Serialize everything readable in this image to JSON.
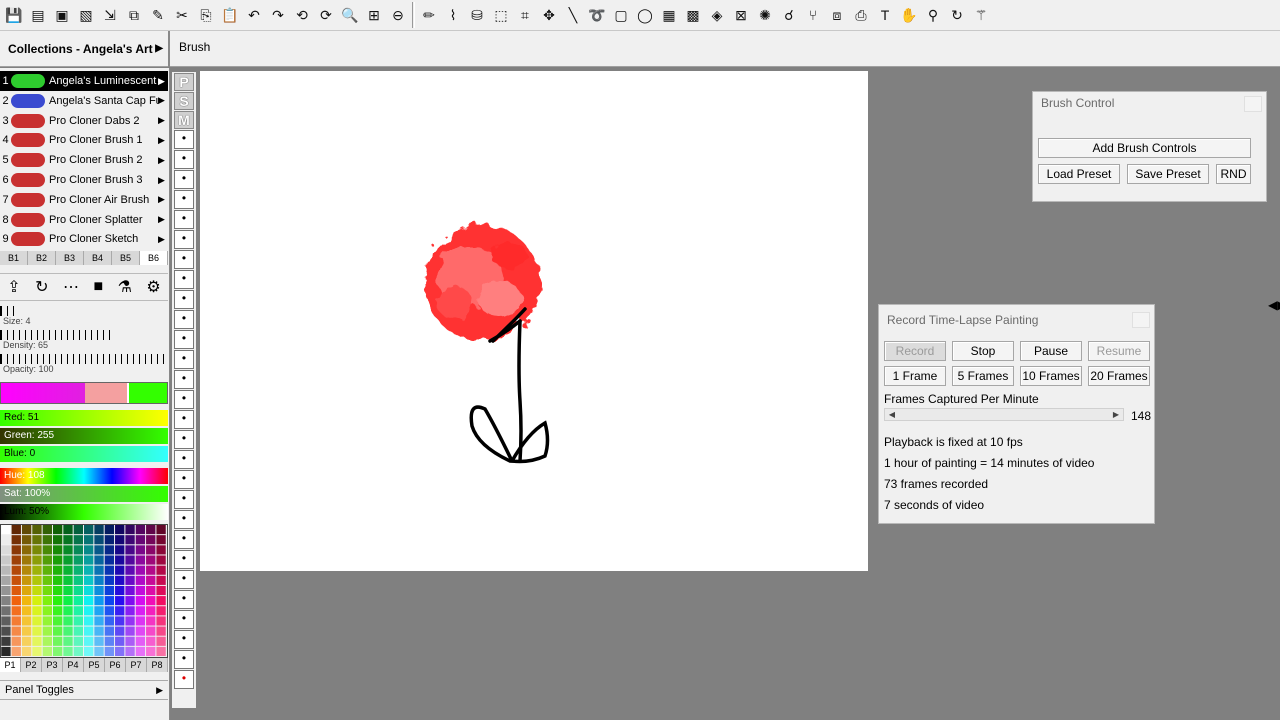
{
  "toolbar": {
    "icons": [
      "save-icon",
      "new-icon",
      "open-icon",
      "save-as-icon",
      "export-icon",
      "export-all-icon",
      "pen-icon",
      "cut-icon",
      "copy-icon",
      "paste-icon",
      "undo-icon",
      "redo-icon",
      "rotate-left-icon",
      "rotate-right-icon",
      "zoom-icon",
      "fit-icon",
      "zoom-out-icon",
      "brush-icon",
      "eyedropper-icon",
      "bucket-icon",
      "select-rect-icon",
      "crop-icon",
      "move-icon",
      "line-icon",
      "lasso-icon",
      "rect-icon",
      "ellipse-icon",
      "pattern-icon",
      "checker-icon",
      "texture-icon",
      "grid-icon",
      "noise-icon",
      "smudge-icon",
      "fork-icon",
      "layers-icon",
      "camera-icon",
      "text-icon",
      "hand-icon",
      "hook-icon",
      "refresh-icon",
      "wand-icon"
    ]
  },
  "header": {
    "collections_label": "Collections - Angela's Art",
    "brush_label": "Brush"
  },
  "brushes": [
    {
      "num": "1",
      "name": "Angela's Luminescent Grass",
      "color": "#2ecc2e"
    },
    {
      "num": "2",
      "name": "Angela's Santa Cap Fur",
      "color": "#3a4ad0"
    },
    {
      "num": "3",
      "name": "Pro Cloner Dabs 2",
      "color": "#c83030"
    },
    {
      "num": "4",
      "name": "Pro Cloner Brush 1",
      "color": "#c83030"
    },
    {
      "num": "5",
      "name": "Pro Cloner Brush 2",
      "color": "#c83030"
    },
    {
      "num": "6",
      "name": "Pro Cloner Brush 3",
      "color": "#c83030"
    },
    {
      "num": "7",
      "name": "Pro Cloner Air Brush",
      "color": "#c83030"
    },
    {
      "num": "8",
      "name": "Pro Cloner Splatter",
      "color": "#c83030"
    },
    {
      "num": "9",
      "name": "Pro Cloner Sketch",
      "color": "#c83030"
    }
  ],
  "bank_tabs": [
    "B1",
    "B2",
    "B3",
    "B4",
    "B5",
    "B6"
  ],
  "bank_active": "B6",
  "sliders": {
    "size": "Size: 4",
    "density": "Density: 65",
    "opacity": "Opacity: 100"
  },
  "color": {
    "red": "Red: 51",
    "green": "Green: 255",
    "blue": "Blue: 0",
    "hue": "Hue: 108",
    "sat": "Sat: 100%",
    "lum": "Lum: 50%",
    "current": "#33ff00"
  },
  "palette_tabs": [
    "P1",
    "P2",
    "P3",
    "P4",
    "P5",
    "P6",
    "P7",
    "P8"
  ],
  "palette_active": "P1",
  "panel_toggles": "Panel Toggles",
  "side_strip": {
    "p": "P",
    "s": "S",
    "m": "M",
    "dot": "•"
  },
  "brush_control": {
    "title": "Brush Control",
    "add": "Add Brush Controls",
    "load": "Load Preset",
    "save": "Save Preset",
    "rnd": "RND"
  },
  "timelapse": {
    "title": "Record Time-Lapse Painting",
    "record": "Record",
    "stop": "Stop",
    "pause": "Pause",
    "resume": "Resume",
    "f1": "1 Frame",
    "f5": "5 Frames",
    "f10": "10 Frames",
    "f20": "20 Frames",
    "fpm_label": "Frames Captured Per Minute",
    "fpm_value": "148",
    "line1": "Playback is fixed at 10 fps",
    "line2": "1 hour of painting = 14 minutes of video",
    "line3": "73 frames recorded",
    "line4": "7 seconds of video"
  }
}
